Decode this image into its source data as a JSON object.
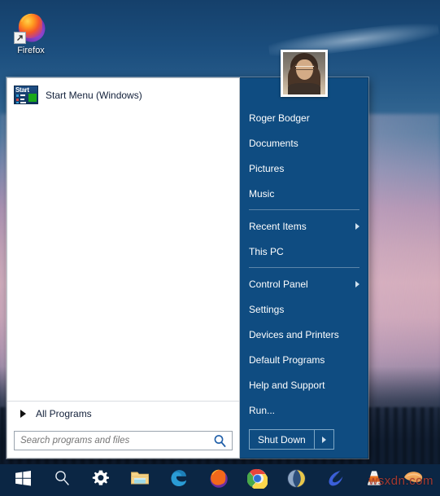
{
  "desktop": {
    "icons": [
      {
        "name": "firefox",
        "label": "Firefox",
        "icon": "firefox-icon",
        "has_shortcut_overlay": true
      }
    ],
    "wallpaper_colors": {
      "sky_top": "#15406b",
      "cloud_pink": "#cfa6b5",
      "treeline": "#0d1a2c"
    }
  },
  "start_menu": {
    "accent_color": "#0f4c81",
    "left_pane": {
      "pinned": [
        {
          "label": "Start Menu (Windows)",
          "icon": "start-menu-tile-icon",
          "tile_word": "Start"
        }
      ],
      "all_programs": {
        "label": "All Programs",
        "icon": "triangle-right-icon"
      },
      "search": {
        "placeholder": "Search programs and files",
        "value": "",
        "icon": "search-icon"
      }
    },
    "right_pane": {
      "avatar": {
        "icon": "user-avatar",
        "alt": "Roger Bodger user picture"
      },
      "items": [
        {
          "label": "Roger Bodger",
          "submenu": false
        },
        {
          "label": "Documents",
          "submenu": false
        },
        {
          "label": "Pictures",
          "submenu": false
        },
        {
          "label": "Music",
          "submenu": false
        },
        {
          "separator_after": true,
          "label": "",
          "submenu": false
        },
        {
          "label": "Recent Items",
          "submenu": true
        },
        {
          "label": "This PC",
          "submenu": false
        },
        {
          "separator_after": true,
          "label": "",
          "submenu": false
        },
        {
          "label": "Control Panel",
          "submenu": true
        },
        {
          "label": "Settings",
          "submenu": false
        },
        {
          "label": "Devices and Printers",
          "submenu": false
        },
        {
          "label": "Default Programs",
          "submenu": false
        },
        {
          "label": "Help and Support",
          "submenu": false
        },
        {
          "label": "Run...",
          "submenu": false
        }
      ],
      "shutdown": {
        "label": "Shut Down",
        "more_icon": "triangle-right-icon"
      }
    }
  },
  "taskbar": {
    "background": "#0b2644",
    "items": [
      {
        "name": "start-button",
        "icon": "windows-logo-icon",
        "label": "Start"
      },
      {
        "name": "search",
        "icon": "search-icon",
        "label": "Search"
      },
      {
        "name": "settings",
        "icon": "gear-icon",
        "label": "Settings"
      },
      {
        "name": "file-explorer",
        "icon": "folder-icon",
        "label": "File Explorer"
      },
      {
        "name": "edge",
        "icon": "edge-icon",
        "label": "Microsoft Edge"
      },
      {
        "name": "firefox",
        "icon": "firefox-icon",
        "label": "Firefox"
      },
      {
        "name": "chrome",
        "icon": "chrome-icon",
        "label": "Google Chrome"
      },
      {
        "name": "seamonkey",
        "icon": "seamonkey-icon",
        "label": "SeaMonkey"
      },
      {
        "name": "pale-moon",
        "icon": "pale-moon-icon",
        "label": "Pale Moon"
      },
      {
        "name": "vlc",
        "icon": "vlc-cone-icon",
        "label": "VLC media player"
      },
      {
        "name": "mango",
        "icon": "mango-icon",
        "label": "Mango"
      }
    ]
  },
  "watermark": {
    "text": "wsxdn.com",
    "color": "#b03a2e"
  }
}
